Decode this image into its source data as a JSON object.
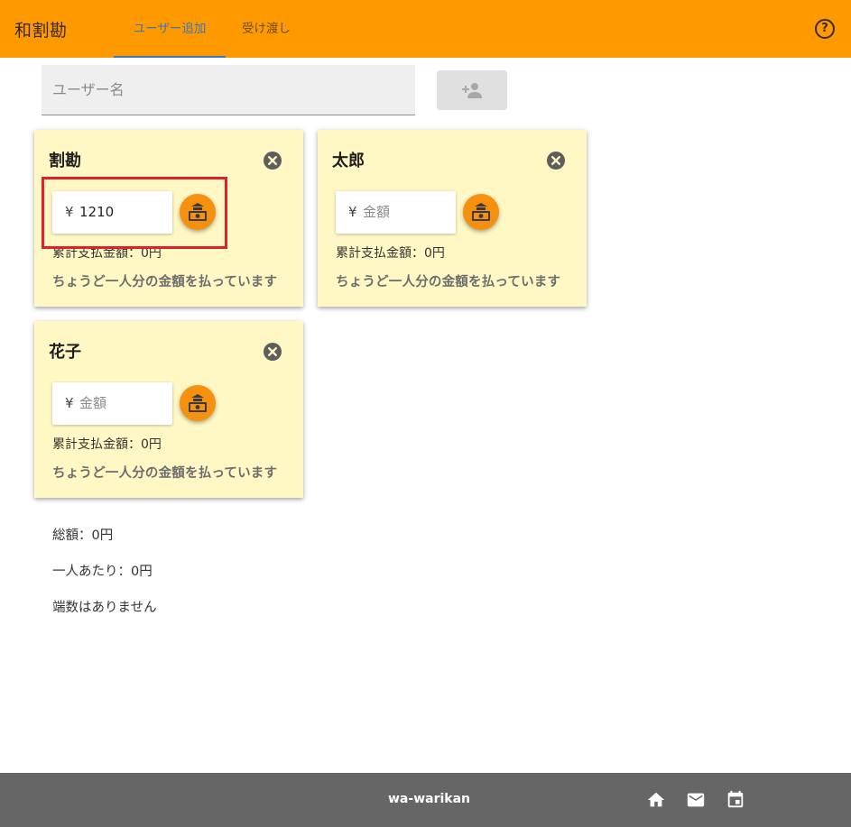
{
  "header": {
    "title": "和割勘",
    "tabs": [
      {
        "label": "ユーザー追加",
        "active": true
      },
      {
        "label": "受け渡し",
        "active": false
      }
    ],
    "help_icon": "help-circle-icon",
    "help_glyph": "?",
    "background_color": "#ff9900",
    "active_tab_color": "#3f76b8"
  },
  "add_user": {
    "name_placeholder": "ユーザー名",
    "name_value": "",
    "button_icon": "person-add-icon"
  },
  "cards": [
    {
      "name": "割勘",
      "currency_symbol": "¥",
      "amount_value": "1210",
      "amount_placeholder": "金額",
      "paid_total": "累計支払金額：0円",
      "status": "ちょうど一人分の金額を払っています"
    },
    {
      "name": "太郎",
      "currency_symbol": "¥",
      "amount_value": "",
      "amount_placeholder": "金額",
      "paid_total": "累計支払金額：0円",
      "status": "ちょうど一人分の金額を払っています"
    },
    {
      "name": "花子",
      "currency_symbol": "¥",
      "amount_value": "",
      "amount_placeholder": "金額",
      "paid_total": "累計支払金額：0円",
      "status": "ちょうど一人分の金額を払っています"
    }
  ],
  "card_icons": {
    "remove": "close-circle-icon",
    "pay": "money-payment-icon"
  },
  "summary": {
    "total": "総額：0円",
    "per_person": "一人あたり：0円",
    "remainder": "端数はありません"
  },
  "footer": {
    "title": "wa-warikan",
    "icons": [
      "home-icon",
      "mail-icon",
      "calendar-icon"
    ]
  },
  "colors": {
    "card_background": "#fff8c4",
    "pay_button": "#f6910f",
    "footer": "#666666",
    "highlight": "#e0202a"
  }
}
